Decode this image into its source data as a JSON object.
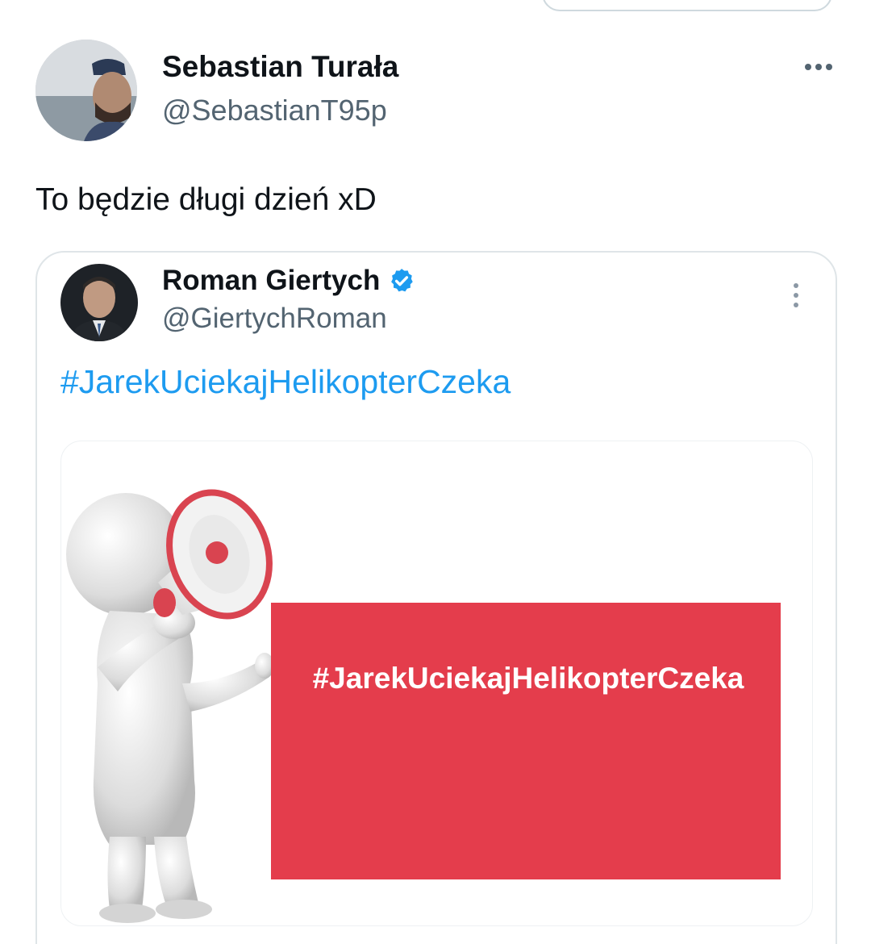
{
  "author": {
    "name": "Sebastian Turała",
    "handle": "@SebastianT95p"
  },
  "tweet": {
    "text": "To będzie długi dzień xD"
  },
  "quoted": {
    "name": "Roman Giertych",
    "handle": "@GiertychRoman",
    "verified": true,
    "text": "#JarekUciekajHelikopterCzeka",
    "image": {
      "sign_text": "#JarekUciekajHelikopterCzeka",
      "sign_color": "#e43d4c"
    }
  },
  "colors": {
    "link": "#1d9bf0",
    "secondary_text": "#536471",
    "verified": "#1d9bf0"
  },
  "icons": {
    "more": "more-horizontal-icon",
    "quote_more": "more-vertical-icon",
    "verified": "verified-badge-icon"
  }
}
